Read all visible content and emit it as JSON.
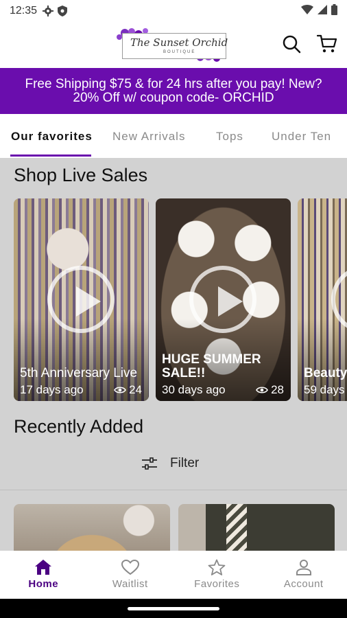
{
  "status": {
    "time": "12:35"
  },
  "header": {
    "logo_text": "The Sunset Orchid",
    "logo_sub": "BOUTIQUE"
  },
  "banner": {
    "line1": "Free Shipping $75 & for 24 hrs after you pay! New?",
    "line2": "20% Off w/ coupon code- ORCHID"
  },
  "tabs": [
    {
      "label": "Our favorites"
    },
    {
      "label": "New Arrivals"
    },
    {
      "label": "Tops"
    },
    {
      "label": "Under Ten"
    }
  ],
  "live": {
    "title": "Shop Live Sales",
    "cards": [
      {
        "title": "5th Anniversary Live",
        "time": "17 days ago",
        "views": "24"
      },
      {
        "title": "HUGE SUMMER SALE!!",
        "time": "30 days ago",
        "views": "28"
      },
      {
        "title": "Beauty",
        "time": "59 days"
      }
    ]
  },
  "recent": {
    "title": "Recently Added",
    "filter_label": "Filter"
  },
  "nav": [
    {
      "label": "Home",
      "icon": "home-icon"
    },
    {
      "label": "Waitlist",
      "icon": "heart-icon"
    },
    {
      "label": "Favorites",
      "icon": "star-icon"
    },
    {
      "label": "Account",
      "icon": "person-icon"
    }
  ],
  "colors": {
    "accent": "#6a0dad",
    "nav_active": "#4b0082"
  }
}
